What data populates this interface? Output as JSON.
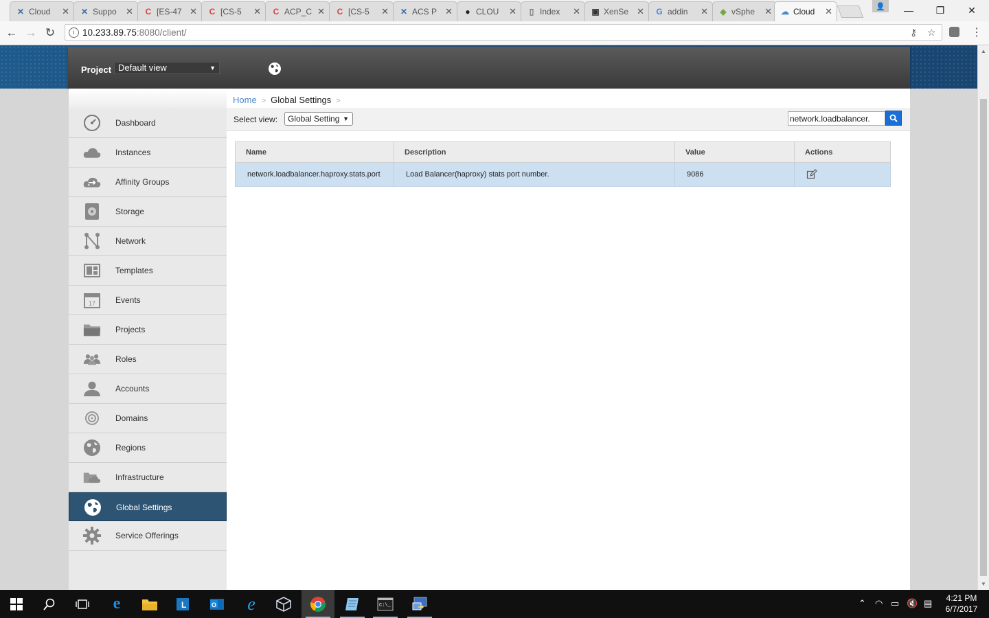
{
  "browser": {
    "tabs": [
      {
        "title": "Cloud",
        "icon": "cross-icon",
        "color": "#3a6aa8"
      },
      {
        "title": "Suppo",
        "icon": "cross-icon",
        "color": "#3a6aa8"
      },
      {
        "title": "[ES-47",
        "icon": "c-icon",
        "color": "#d64541"
      },
      {
        "title": "[CS-5",
        "icon": "c-icon",
        "color": "#d64541"
      },
      {
        "title": "ACP_C",
        "icon": "c-icon",
        "color": "#d64541"
      },
      {
        "title": "[CS-5",
        "icon": "c-icon",
        "color": "#d64541"
      },
      {
        "title": "ACS P",
        "icon": "cross-icon",
        "color": "#3a6aa8"
      },
      {
        "title": "CLOU",
        "icon": "github-icon",
        "color": "#222222"
      },
      {
        "title": "Index",
        "icon": "page-icon",
        "color": "#777777"
      },
      {
        "title": "XenSe",
        "icon": "xen-icon",
        "color": "#333333"
      },
      {
        "title": "addin",
        "icon": "google-icon",
        "color": "#4285f4"
      },
      {
        "title": "vSphe",
        "icon": "vsphere-icon",
        "color": "#6ba539"
      },
      {
        "title": "Cloud",
        "icon": "cloud-icon",
        "color": "#4a8ac8"
      }
    ],
    "url_host": "10.233.89.75",
    "url_rest": ":8080/client/"
  },
  "header": {
    "project_label": "Project",
    "project_value": "Default view"
  },
  "sidebar": {
    "items": [
      {
        "label": "Dashboard",
        "icon": "dashboard-icon"
      },
      {
        "label": "Instances",
        "icon": "cloud-icon"
      },
      {
        "label": "Affinity Groups",
        "icon": "affinity-icon"
      },
      {
        "label": "Storage",
        "icon": "storage-icon"
      },
      {
        "label": "Network",
        "icon": "network-icon"
      },
      {
        "label": "Templates",
        "icon": "templates-icon"
      },
      {
        "label": "Events",
        "icon": "calendar-icon"
      },
      {
        "label": "Projects",
        "icon": "folder-icon"
      },
      {
        "label": "Roles",
        "icon": "roles-icon"
      },
      {
        "label": "Accounts",
        "icon": "user-icon"
      },
      {
        "label": "Domains",
        "icon": "target-icon"
      },
      {
        "label": "Regions",
        "icon": "globe-icon"
      },
      {
        "label": "Infrastructure",
        "icon": "infrastructure-icon"
      },
      {
        "label": "Global Settings",
        "icon": "globe-icon"
      },
      {
        "label": "Service Offerings",
        "icon": "gear-icon"
      }
    ],
    "active": "Global Settings",
    "calendar_day": "17"
  },
  "breadcrumb": {
    "home": "Home",
    "current": "Global Settings",
    "separator": ">"
  },
  "view_bar": {
    "label": "Select view:",
    "selected": "Global Setting",
    "search_value": "network.loadbalancer."
  },
  "table": {
    "columns": [
      "Name",
      "Description",
      "Value",
      "Actions"
    ],
    "rows": [
      {
        "name": "network.loadbalancer.haproxy.stats.port",
        "description": "Load Balancer(haproxy) stats port number.",
        "value": "9086"
      }
    ]
  },
  "taskbar": {
    "time": "4:21 PM",
    "date": "6/7/2017"
  },
  "colors": {
    "accent": "#2d5473",
    "link": "#4a8ac8",
    "row_highlight": "#cde0f2",
    "search_button": "#1a6fd6"
  }
}
